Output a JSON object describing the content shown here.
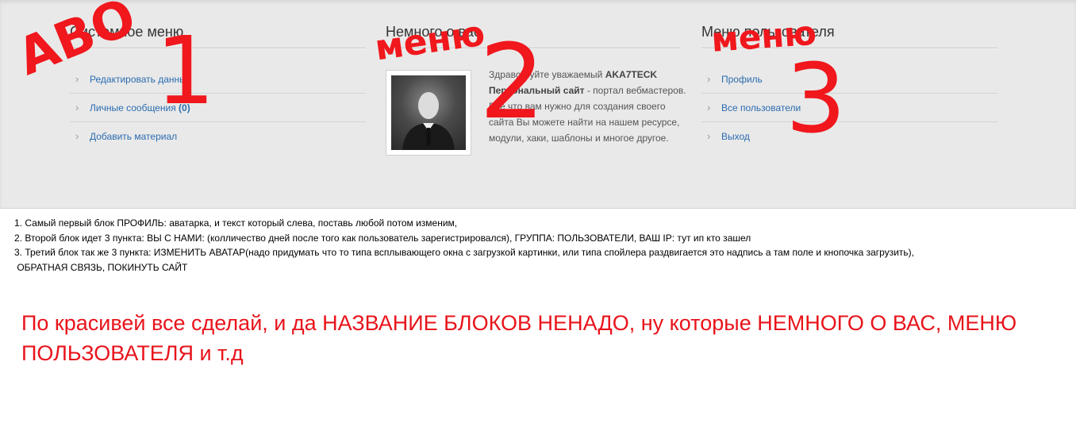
{
  "blocks": {
    "system_menu": {
      "title": "Системное меню",
      "items": [
        {
          "label": "Редактировать данные"
        },
        {
          "label": "Личные сообщения",
          "count": "(0)"
        },
        {
          "label": "Добавить материал"
        }
      ]
    },
    "about": {
      "title": "Немного о вас",
      "greeting": "Здравствуйте уважаемый",
      "username": "AKA7TECK",
      "site_name": "Персональный сайт",
      "text": " - портал вебмастеров. Все что вам нужно для создания своего сайта Вы можете найти на нашем ресурсе, модули, хаки, шаблоны и многое другое."
    },
    "user_menu": {
      "title": "Меню пользователя",
      "items": [
        {
          "label": "Профиль"
        },
        {
          "label": "Все пользователи"
        },
        {
          "label": "Выход"
        }
      ]
    }
  },
  "instructions": [
    "1. Самый первый блок ПРОФИЛЬ: аватарка, и текст который слева, поставь любой потом изменим,",
    "2. Второй блок идет 3 пункта: ВЫ С НАМИ: (колличество дней после того как пользователь зарегистрировался), ГРУППА: ПОЛЬЗОВАТЕЛИ, ВАШ IP: тут ип кто зашел",
    "3. Третий блок так же 3 пункта: ИЗМЕНИТЬ АВАТАР(надо придумать что то типа всплывающего окна с загрузкой картинки, или типа спойлера раздвигается это надпись а там поле и кнопочка загрузить),",
    " ОБРАТНАЯ СВЯЗЬ, ПОКИНУТЬ САЙТ"
  ],
  "note": "По красивей все сделай, и да НАЗВАНИЕ БЛОКОВ НЕНАДО, ну которые НЕМНОГО О ВАС, МЕНЮ ПОЛЬЗОВАТЕЛЯ и т.д",
  "annotations": {
    "a1": "АВО",
    "n1": "1",
    "a2": "меню",
    "n2": "2",
    "a3": "меню",
    "n3": "3"
  },
  "colors": {
    "panel_bg": "#e9e9e9",
    "link": "#2b6cb0",
    "annotation_red": "#f0171d",
    "note_red": "#e8131b"
  }
}
